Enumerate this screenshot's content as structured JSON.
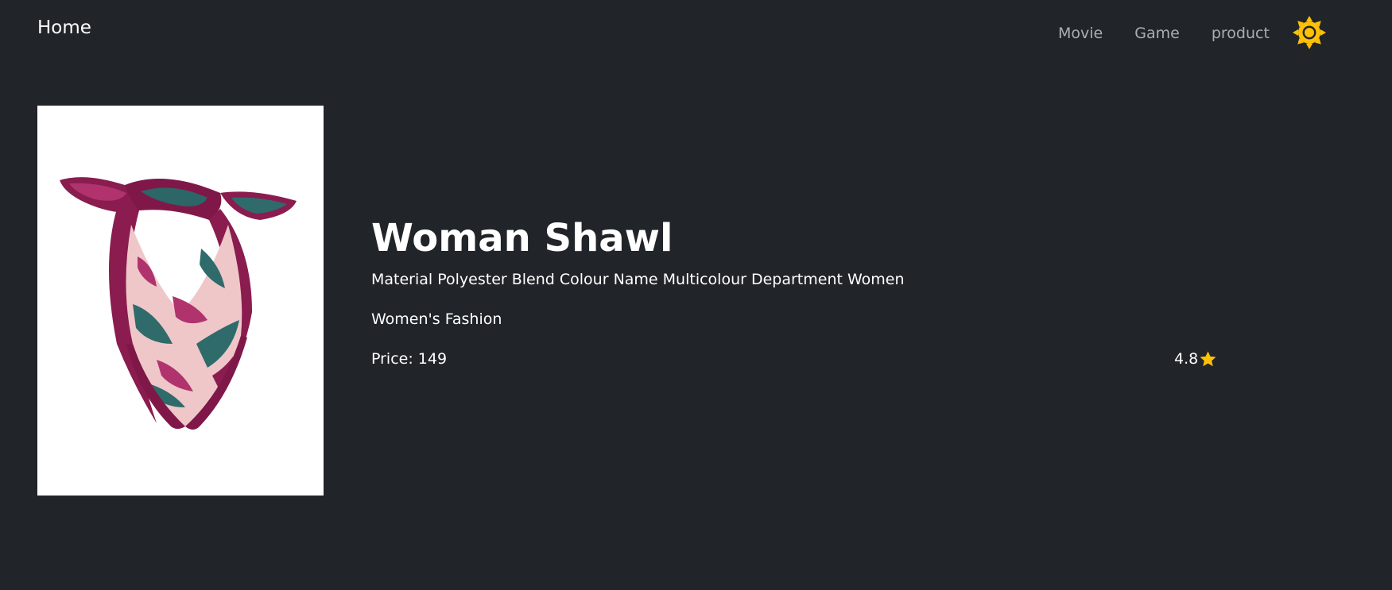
{
  "navbar": {
    "brand": "Home",
    "links": [
      {
        "label": "Movie"
      },
      {
        "label": "Game"
      },
      {
        "label": "product"
      }
    ],
    "theme_icon": "sun-icon",
    "theme_icon_color": "#ffc107"
  },
  "product": {
    "image_icon": "scarf-image",
    "title": "Woman Shawl",
    "description": "Material Polyester Blend Colour Name Multicolour Department Women",
    "category": "Women's Fashion",
    "price_text": "Price: 149",
    "rating": "4.8",
    "rating_icon": "star-icon",
    "rating_color": "#ffc107"
  },
  "colors": {
    "background": "#212529",
    "text": "#ffffff",
    "nav_text": "rgba(255,255,255,0.62)",
    "accent": "#ffc107"
  }
}
